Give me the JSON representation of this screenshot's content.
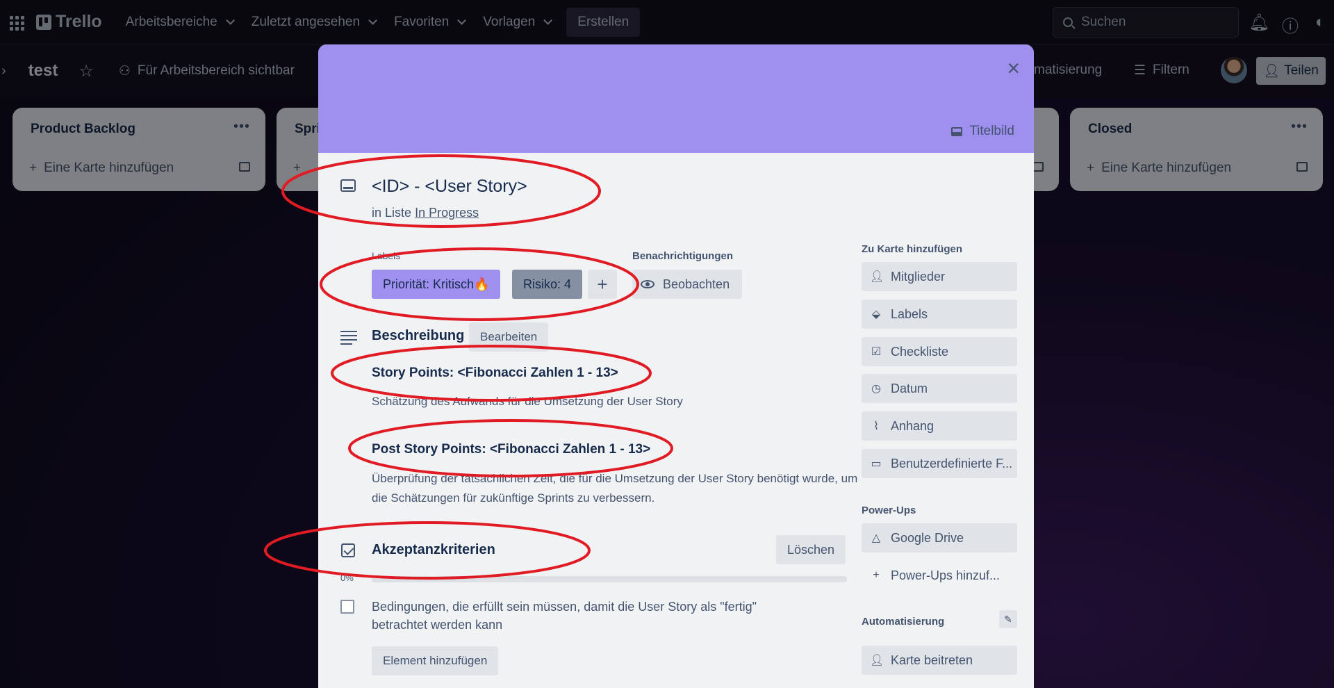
{
  "topnav": {
    "logo": "Trello",
    "menu": [
      {
        "label": "Arbeitsbereiche"
      },
      {
        "label": "Zuletzt angesehen"
      },
      {
        "label": "Favoriten"
      },
      {
        "label": "Vorlagen"
      }
    ],
    "create_label": "Erstellen",
    "search_placeholder": "Suchen"
  },
  "boardbar": {
    "title": "test",
    "visibility": "Für Arbeitsbereich sichtbar",
    "automation_partial": "matisierung",
    "filter": "Filtern",
    "share": "Teilen"
  },
  "lists": [
    {
      "title": "Product Backlog",
      "add": "Eine Karte hinzufügen"
    },
    {
      "title": "Spri",
      "add": ""
    },
    {
      "title": "",
      "add": ""
    },
    {
      "title": "Closed",
      "add": "Eine Karte hinzufügen"
    }
  ],
  "modal": {
    "cover_button": "Titelbild",
    "title": "<ID> - <User Story>",
    "in_list_prefix": "in Liste",
    "in_list_link": "In Progress",
    "labels_heading": "Labels",
    "labels": [
      {
        "text": "Priorität: Kritisch🔥",
        "color": "#9f8fef"
      },
      {
        "text": "Risiko: 4",
        "color": "#8590a2"
      }
    ],
    "notifications_heading": "Benachrichtigungen",
    "watch_label": "Beobachten",
    "description_title": "Beschreibung",
    "edit_label": "Bearbeiten",
    "story_points_title": "Story Points: <Fibonacci Zahlen 1 - 13>",
    "story_points_text": "Schätzung des Aufwands für die Umsetzung der User Story",
    "post_story_points_title": "Post Story Points: <Fibonacci Zahlen 1 - 13>",
    "post_story_points_text": "Überprüfung der tatsächlichen Zeit, die für die Umsetzung der User Story benötigt wurde, um die Schätzungen für zukünftige Sprints zu verbessern.",
    "checklist_title": "Akzeptanzkriterien",
    "delete_label": "Löschen",
    "progress_percent": "0%",
    "progress_value": 0,
    "checklist_item": "Bedingungen, die erfüllt sein müssen, damit die User Story als \"fertig\" betrachtet werden kann",
    "add_item_label": "Element hinzufügen"
  },
  "sidebar": {
    "add_heading": "Zu Karte hinzufügen",
    "add_items": [
      {
        "label": "Mitglieder",
        "icon": "person-icon"
      },
      {
        "label": "Labels",
        "icon": "tag-icon"
      },
      {
        "label": "Checkliste",
        "icon": "checklist-icon"
      },
      {
        "label": "Datum",
        "icon": "clock-icon"
      },
      {
        "label": "Anhang",
        "icon": "paperclip-icon"
      },
      {
        "label": "Benutzerdefinierte F...",
        "icon": "custom-fields-icon"
      }
    ],
    "powerups_heading": "Power-Ups",
    "google_drive": "Google Drive",
    "add_powerups": "Power-Ups hinzuf...",
    "automation_heading": "Automatisierung",
    "join_card": "Karte beitreten"
  },
  "colors": {
    "annotation": "#e01b24",
    "cover": "#9f8fef",
    "progress": "#22a06b"
  }
}
